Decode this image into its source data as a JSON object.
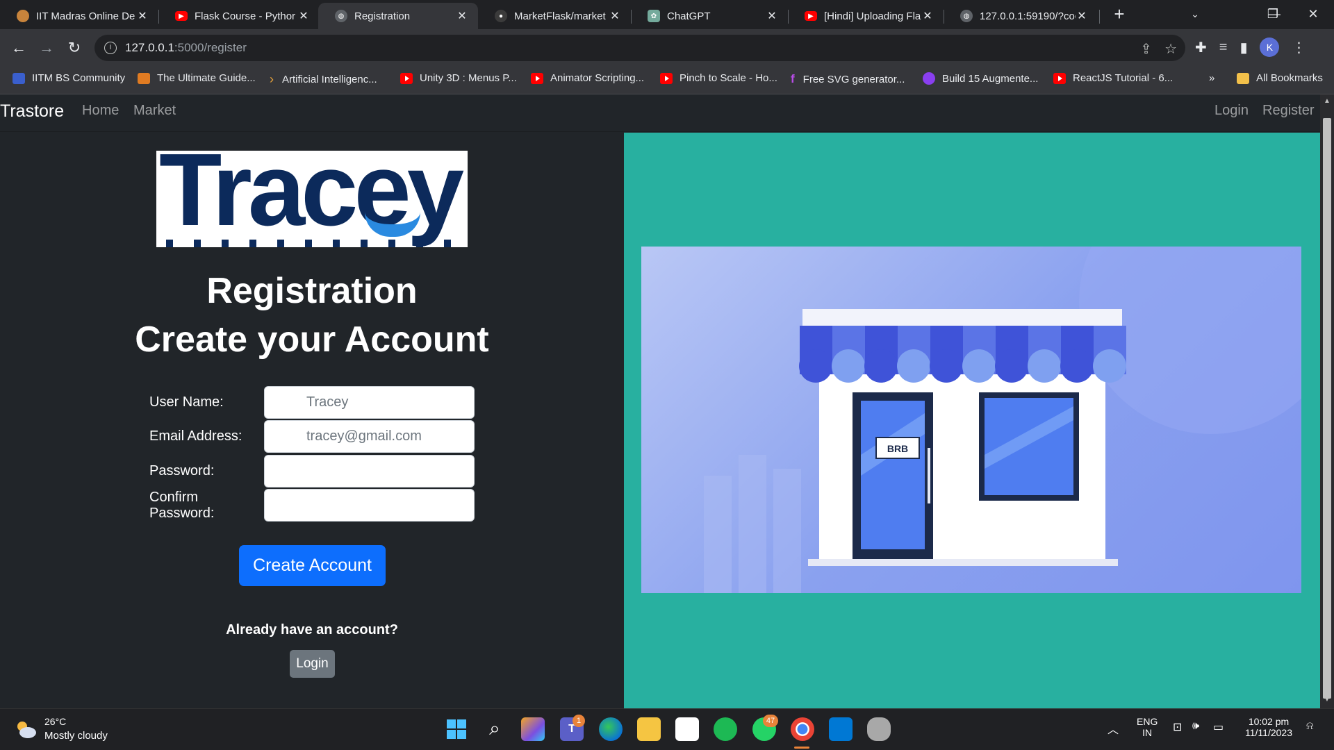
{
  "browser": {
    "tabs": [
      {
        "title": "IIT Madras Online De",
        "favicon": "iitm-icon",
        "color": "#c8843c",
        "active": false
      },
      {
        "title": "Flask Course - Pythor",
        "favicon": "youtube-icon",
        "color": "#ff0000",
        "active": false
      },
      {
        "title": "Registration",
        "favicon": "globe-icon",
        "color": "#9aa0a6",
        "active": true
      },
      {
        "title": "MarketFlask/market",
        "favicon": "github-icon",
        "color": "#3b3b3b",
        "active": false
      },
      {
        "title": "ChatGPT",
        "favicon": "chatgpt-icon",
        "color": "#74aa9c",
        "active": false
      },
      {
        "title": "[Hindi] Uploading Fla",
        "favicon": "youtube-icon",
        "color": "#ff0000",
        "active": false
      },
      {
        "title": "127.0.0.1:59190/?coc",
        "favicon": "globe-icon",
        "color": "#9aa0a6",
        "active": false
      }
    ],
    "url_host": "127.0.0.1",
    "url_path": ":5000/register",
    "profile_initial": "K"
  },
  "bookmarks": [
    {
      "label": "IITM BS Community",
      "icon": "iitm-community-icon"
    },
    {
      "label": "The Ultimate Guide...",
      "icon": "guide-icon"
    },
    {
      "label": "Artificial Intelligenc...",
      "icon": "chevron-icon"
    },
    {
      "label": "Unity 3D : Menus P...",
      "icon": "youtube-icon"
    },
    {
      "label": "Animator Scripting...",
      "icon": "youtube-icon"
    },
    {
      "label": "Pinch to Scale - Ho...",
      "icon": "youtube-icon"
    },
    {
      "label": "Free SVG generator...",
      "icon": "svg-generator-icon"
    },
    {
      "label": "Build 15 Augmente...",
      "icon": "udemy-icon"
    },
    {
      "label": "ReactJS Tutorial - 6...",
      "icon": "youtube-icon"
    }
  ],
  "bookmarks_more": "»",
  "all_bookmarks": "All Bookmarks",
  "site": {
    "brand": "Trastore",
    "nav": {
      "home": "Home",
      "market": "Market",
      "login": "Login",
      "register": "Register"
    },
    "logo_text": "Tracey",
    "heading_1": "Registration",
    "heading_2": "Create your Account",
    "form": {
      "username_label": "User Name:",
      "username_value": "Tracey",
      "email_label": "Email Address:",
      "email_value": "tracey@gmail.com",
      "password_label": "Password:",
      "password_value": "",
      "confirm_label": "Confirm Password:",
      "confirm_value": "",
      "submit": "Create Account"
    },
    "already_text": "Already have an account?",
    "login_button": "Login",
    "store_sign": "BRB",
    "colors": {
      "primary": "#0d6efd",
      "secondary": "#6c757d",
      "panel": "#28b0a0",
      "dark": "#212529"
    }
  },
  "taskbar": {
    "weather_temp": "26°C",
    "weather_desc": "Mostly cloudy",
    "teams_badge": "1",
    "whatsapp_badge": "47",
    "lang_1": "ENG",
    "lang_2": "IN",
    "time": "10:02 pm",
    "date": "11/11/2023"
  }
}
